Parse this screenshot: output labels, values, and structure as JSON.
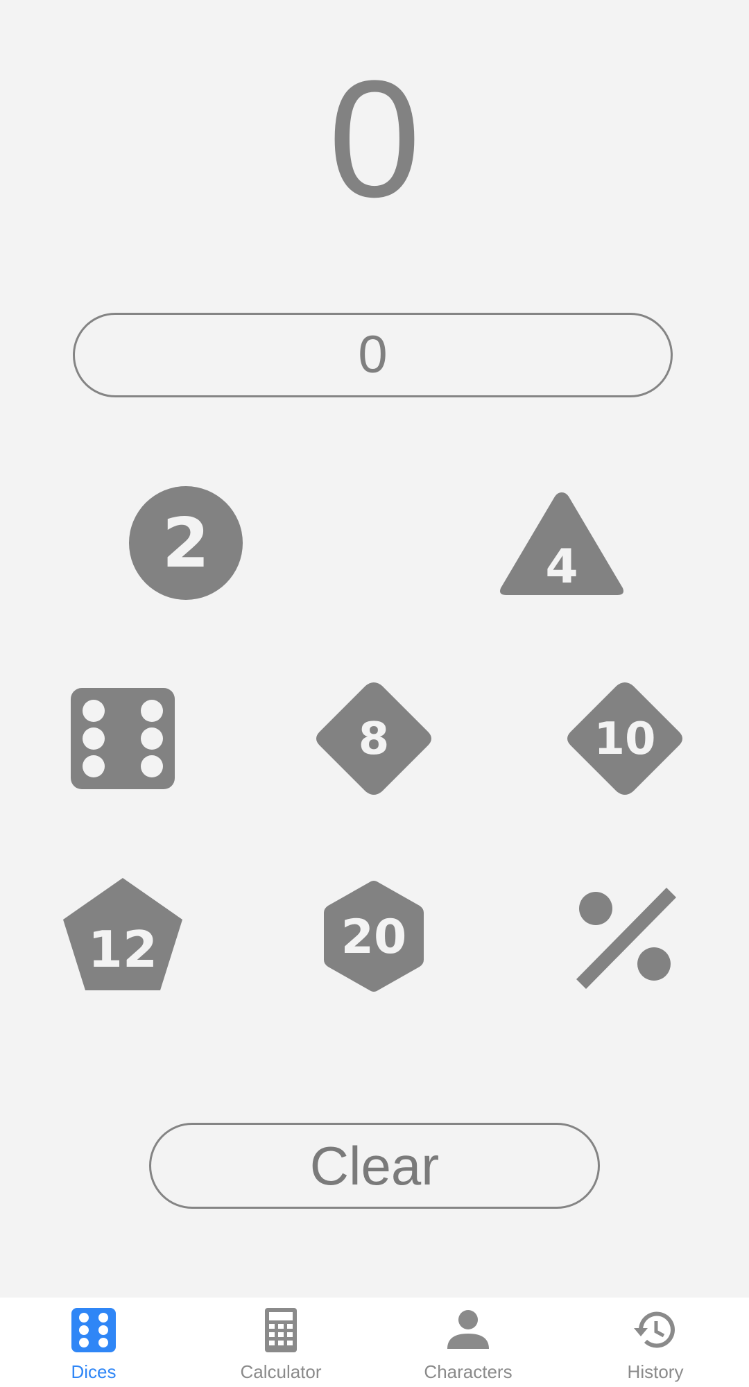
{
  "total_value": "0",
  "expression_value": "0",
  "dice": {
    "d2_label": "2",
    "d4_label": "4",
    "d8_label": "8",
    "d10_label": "10",
    "d12_label": "12",
    "d20_label": "20",
    "d6_icon": "six-sided-die-icon",
    "percent_icon": "percent-icon"
  },
  "clear_label": "Clear",
  "nav": {
    "items": [
      {
        "label": "Dices",
        "icon": "dice-grid-icon",
        "active": true
      },
      {
        "label": "Calculator",
        "icon": "calculator-icon",
        "active": false
      },
      {
        "label": "Characters",
        "icon": "person-icon",
        "active": false
      },
      {
        "label": "History",
        "icon": "history-icon",
        "active": false
      }
    ]
  },
  "colors": {
    "background": "#f3f3f3",
    "icon_gray": "#828282",
    "accent_blue": "#2f86f6",
    "nav_background": "#ffffff"
  }
}
